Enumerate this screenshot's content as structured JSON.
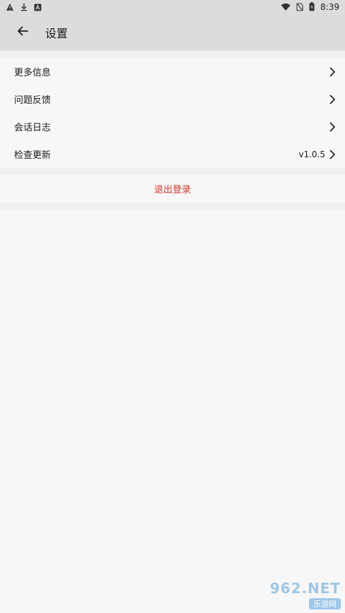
{
  "status_bar": {
    "time": "8:39"
  },
  "header": {
    "title": "设置"
  },
  "settings": {
    "items": [
      {
        "label": "更多信息",
        "value": ""
      },
      {
        "label": "问题反馈",
        "value": ""
      },
      {
        "label": "会话日志",
        "value": ""
      },
      {
        "label": "检查更新",
        "value": "v1.0.5"
      }
    ],
    "logout_label": "退出登录"
  },
  "watermark": {
    "line1": "962.NET",
    "line2": "乐游网"
  },
  "colors": {
    "logout": "#d0362a",
    "bar": "#dcdcdc",
    "page": "#f7f7f7"
  }
}
